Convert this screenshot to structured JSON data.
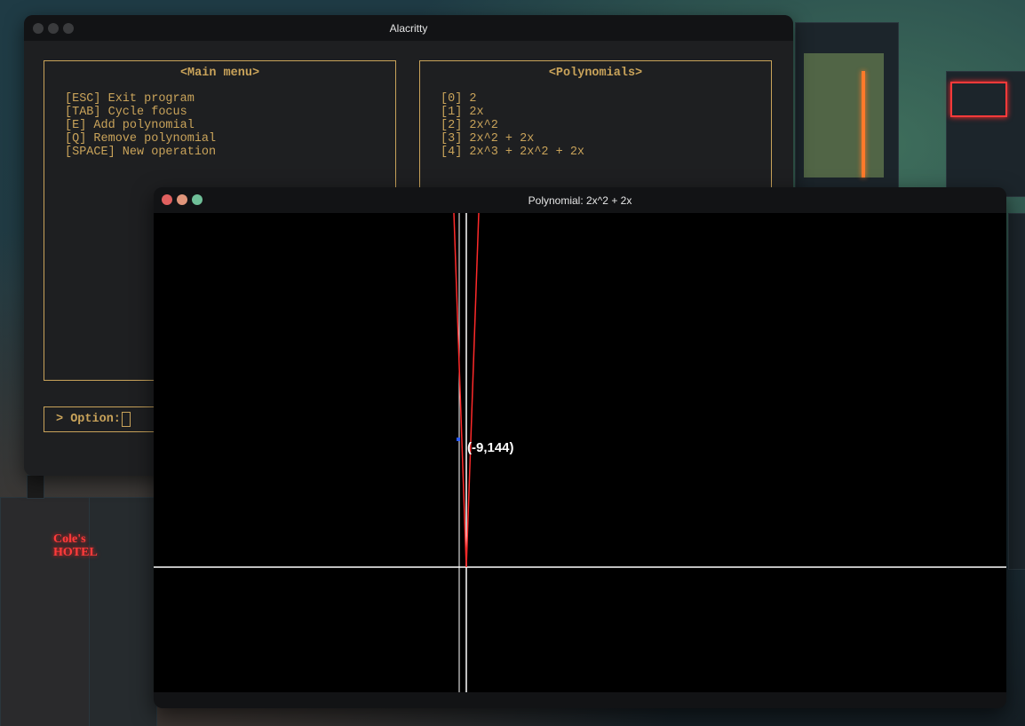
{
  "alacritty": {
    "title": "Alacritty",
    "main_menu": {
      "title": "<Main menu>",
      "items": [
        "[ESC] Exit program",
        "[TAB] Cycle focus",
        "[E] Add polynomial",
        "[Q] Remove polynomial",
        "[SPACE] New operation"
      ]
    },
    "polynomials": {
      "title": "<Polynomials>",
      "items": [
        "[0] 2",
        "[1] 2x",
        "[2] 2x^2",
        "[3] 2x^2 + 2x",
        "[4] 2x^3 + 2x^2 + 2x"
      ]
    },
    "prompt": {
      "label": "> Option:",
      "value": ""
    }
  },
  "plot_window": {
    "title": "Polynomial: 2x^2 + 2x",
    "hover_label": "(-9,144)"
  },
  "desktop": {
    "sign_text": "Cole's HOTEL"
  },
  "colors": {
    "terminal_fg": "#c9a35a",
    "terminal_bg": "#1e1f21",
    "curve": "#ff2a2a",
    "axes": "#ffffff",
    "close": "#e0605f",
    "minimize": "#e0957a",
    "maximize": "#6fbf98"
  }
}
